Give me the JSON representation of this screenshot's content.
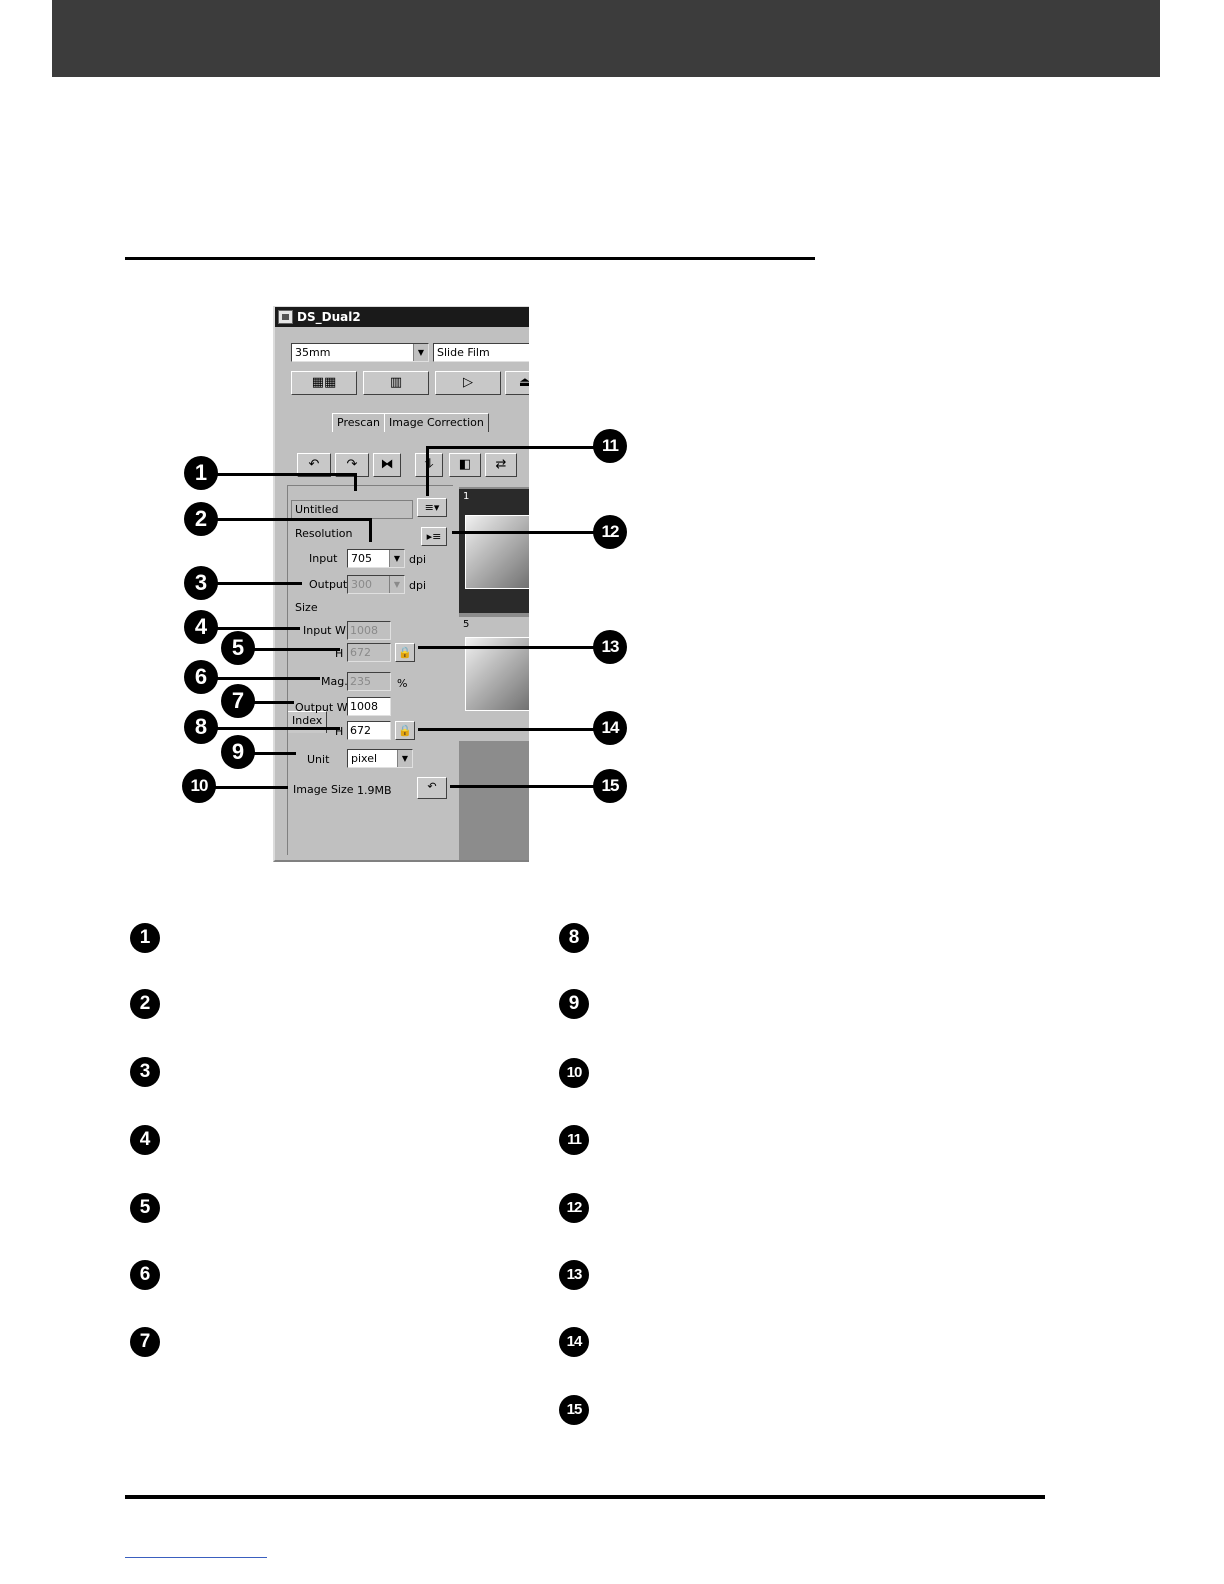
{
  "window": {
    "title": "DS_Dual2",
    "film_format": "35mm",
    "film_type": "Slide Film",
    "tabs": [
      "Index",
      "Prescan",
      "Image Correction"
    ]
  },
  "settings": {
    "job_name": "Untitled",
    "resolution_label": "Resolution",
    "input_label": "Input",
    "input_value": "705",
    "input_unit": "dpi",
    "output_label": "Output",
    "output_value": "300",
    "output_unit": "dpi",
    "size_label": "Size",
    "input_w_label": "Input W",
    "input_w_value": "1008",
    "input_h_label": "H",
    "input_h_value": "672",
    "mag_label": "Mag.",
    "mag_value": "235",
    "mag_unit": "%",
    "output_w_label": "Output W",
    "output_w_value": "1008",
    "output_h_label": "H",
    "output_h_value": "672",
    "unit_label": "Unit",
    "unit_value": "pixel",
    "image_size_label": "Image Size",
    "image_size_value": "1.9MB"
  },
  "thumbnails": [
    {
      "number": "1"
    },
    {
      "number": "5"
    }
  ],
  "callouts": [
    "1",
    "2",
    "3",
    "4",
    "5",
    "6",
    "7",
    "8",
    "9",
    "10",
    "11",
    "12",
    "13",
    "14",
    "15"
  ],
  "legend_left": [
    "1",
    "2",
    "3",
    "4",
    "5",
    "6",
    "7"
  ],
  "legend_right": [
    "8",
    "9",
    "10",
    "11",
    "12",
    "13",
    "14",
    "15"
  ]
}
